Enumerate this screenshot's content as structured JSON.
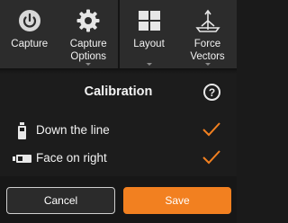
{
  "toolbar": {
    "items": [
      {
        "label": "Capture",
        "icon": "power-icon"
      },
      {
        "label": "Capture\nOptions",
        "icon": "gear-icon"
      },
      {
        "label": "Layout",
        "icon": "grid-icon"
      },
      {
        "label": "Force\nVectors",
        "icon": "force-vectors-icon"
      }
    ]
  },
  "calibration": {
    "title": "Calibration",
    "help_symbol": "?",
    "options": [
      {
        "label": "Down the line",
        "icon": "camera-vertical-icon",
        "checked": true
      },
      {
        "label": "Face on right",
        "icon": "camera-horizontal-icon",
        "checked": true
      }
    ]
  },
  "footer": {
    "cancel_label": "Cancel",
    "save_label": "Save"
  },
  "colors": {
    "accent": "#f28020",
    "background": "#1c1c1c",
    "toolbar": "#2c2c2c"
  }
}
